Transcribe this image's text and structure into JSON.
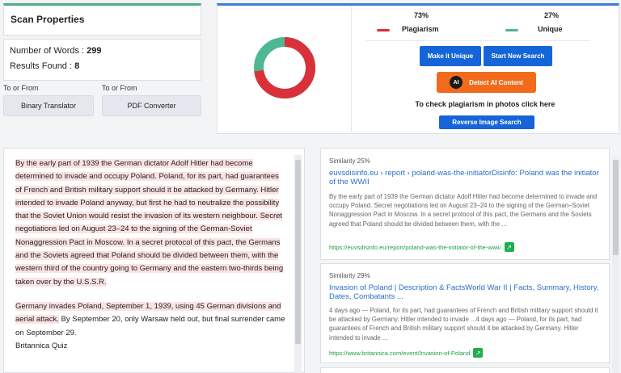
{
  "scan_properties": {
    "title": "Scan Properties",
    "words_label": "Number of Words : ",
    "words_value": "299",
    "results_label": "Results Found : ",
    "results_value": "8"
  },
  "tools": [
    {
      "label": "To or From",
      "button": "Binary Translator"
    },
    {
      "label": "To or From",
      "button": "PDF Converter"
    }
  ],
  "result": {
    "plagiarism_pct": "73%",
    "unique_pct": "27%",
    "plagiarism_label": "Plagiarism",
    "unique_label": "Unique",
    "plagiarism_value": 73,
    "unique_value": 27,
    "colors": {
      "plagiarism": "#d9313a",
      "unique": "#4db892"
    },
    "make_unique": "Make it Unique",
    "start_new": "Start New Search",
    "detect_ai": "Detect AI Content",
    "ai_badge": "AI",
    "photo_text": "To check plagiarism in photos click here",
    "reverse_image": "Reverse Image Search"
  },
  "text": {
    "p1_highlighted": "By the early part of 1939 the German dictator Adolf Hitler had become determined to invade and occupy Poland. Poland, for its part, had guarantees of French and British military support should it be attacked by Germany. Hitler intended to invade Poland anyway, but first he had to neutralize the possibility that the Soviet Union would resist the invasion of its western neighbour. Secret negotiations led on August 23–24 to the signing of the German-Soviet Nonaggression Pact in Moscow. In a secret protocol of this pact, the Germans and the Soviets agreed that Poland should be divided between them, with the western third of the country going to Germany and the eastern two-thirds being taken over by the U.S.S.R.",
    "p2_highlighted": "Germany invades Poland, September 1, 1939, using 45 German divisions and aerial attack.",
    "p2_plain": " By September 20, only Warsaw held out, but final surrender came on September 29.",
    "p3": "Britannica Quiz"
  },
  "sources": [
    {
      "similarity": "Similarity 25%",
      "title": "euvsdisinfo.eu › report › poland-was-the-initiatorDisinfo: Poland was the initiator of the WWII",
      "snippet": "By the early part of 1939 the German dictator Adolf Hitler had become determined to invade and occupy Poland. Secret negotiations led on August 23–24 to the signing of the German–Soviet Nonaggression Pact in Moscow. In a secret protocol of this pact, the Germans and the Soviets agreed that Poland should be divided between them, with the ...",
      "url": "https://euvsdisinfo.eu/report/poland-was-the-initiator-of-the-wwii/"
    },
    {
      "similarity": "Similarity 29%",
      "title": "Invasion of Poland | Description & FactsWorld War II | Facts, Summary, History, Dates, Combatants ...",
      "snippet": "4 days ago — Poland, for its part, had guarantees of French and British military support should it be attacked by Germany. Hitler intended to invade ...4 days ago — Poland, for its part, had guarantees of French and British military support should it be attacked by Germany. Hitler intended to invade ...",
      "url": "https://www.britannica.com/event/Invasion-of-Poland"
    }
  ]
}
